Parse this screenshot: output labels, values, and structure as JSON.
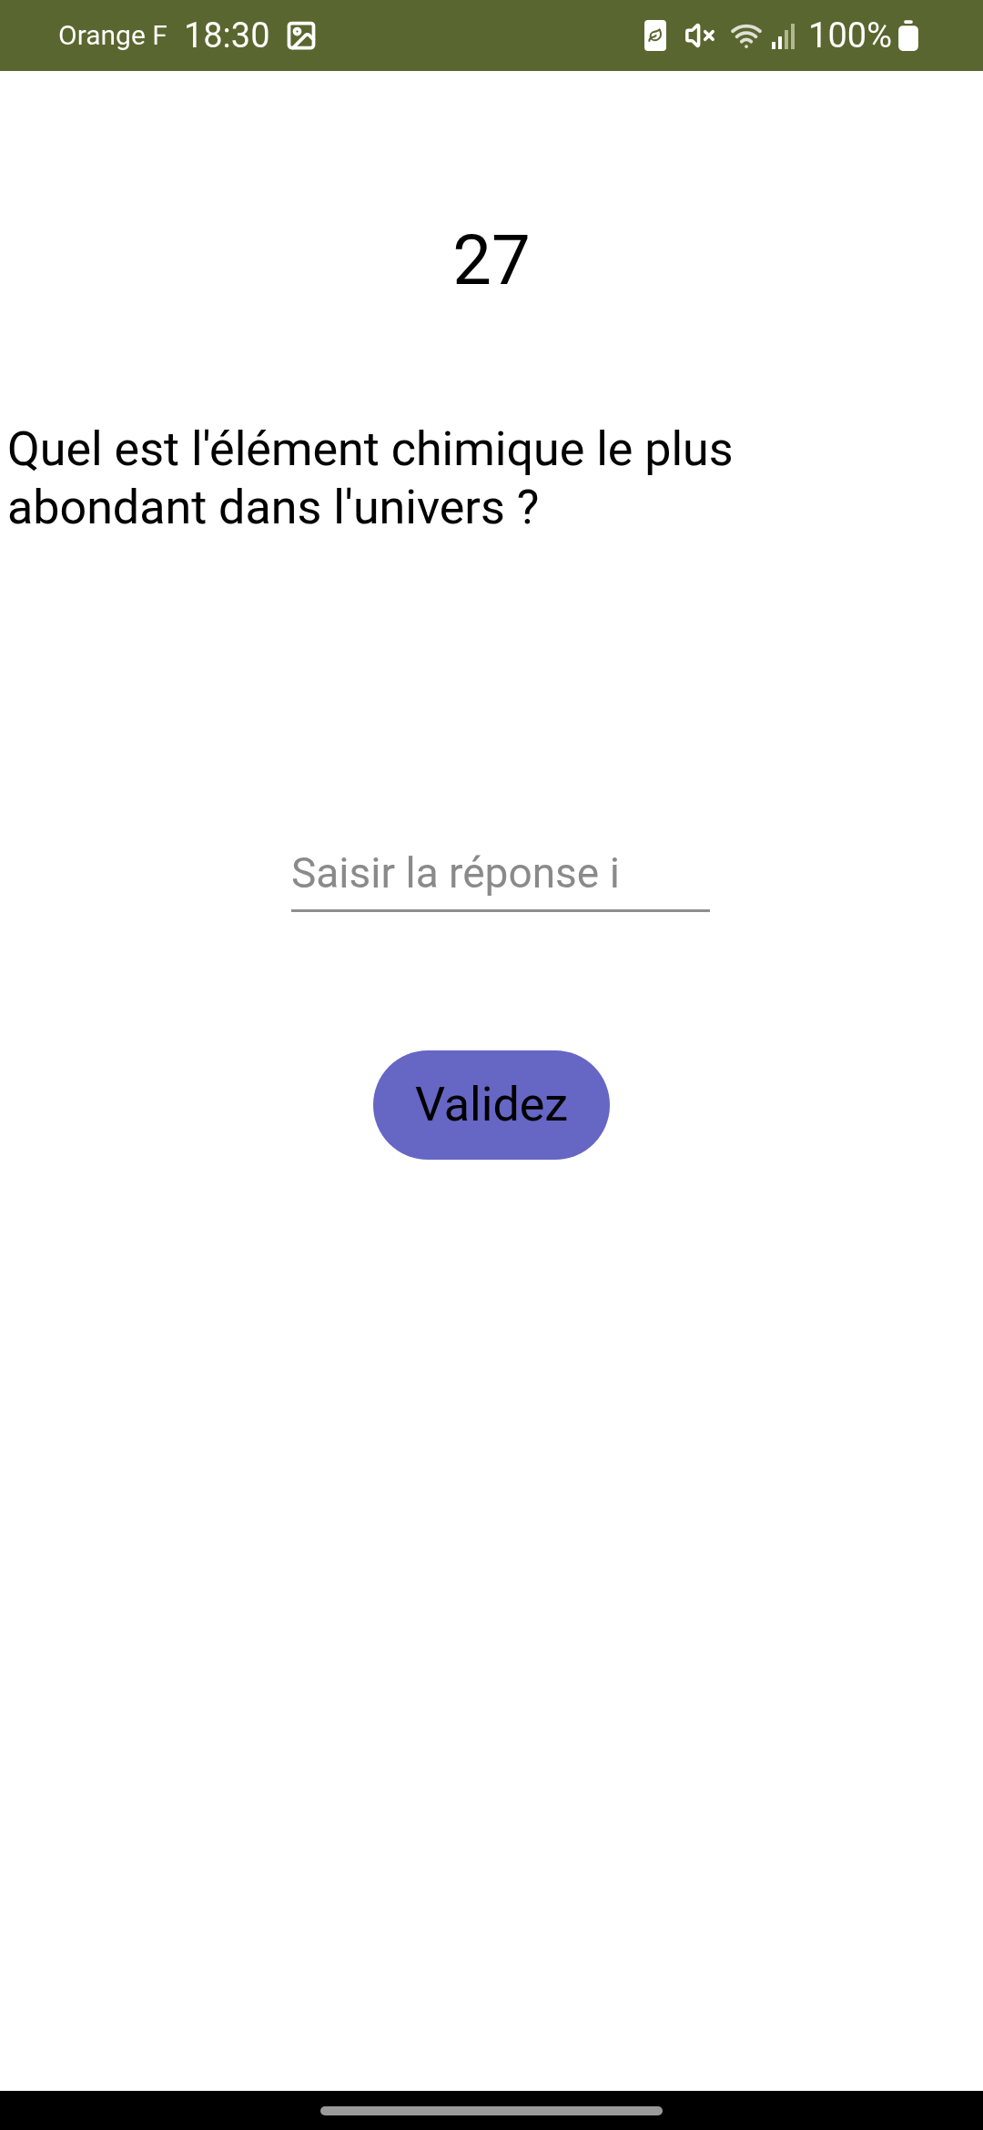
{
  "status_bar": {
    "carrier": "Orange F",
    "time": "18:30",
    "battery": "100%"
  },
  "quiz": {
    "number": "27",
    "question": "Quel est l'élément chimique le plus abondant dans l'univers ?"
  },
  "answer_field": {
    "placeholder": "Saisir la réponse i"
  },
  "submit_button": {
    "label": "Validez"
  }
}
